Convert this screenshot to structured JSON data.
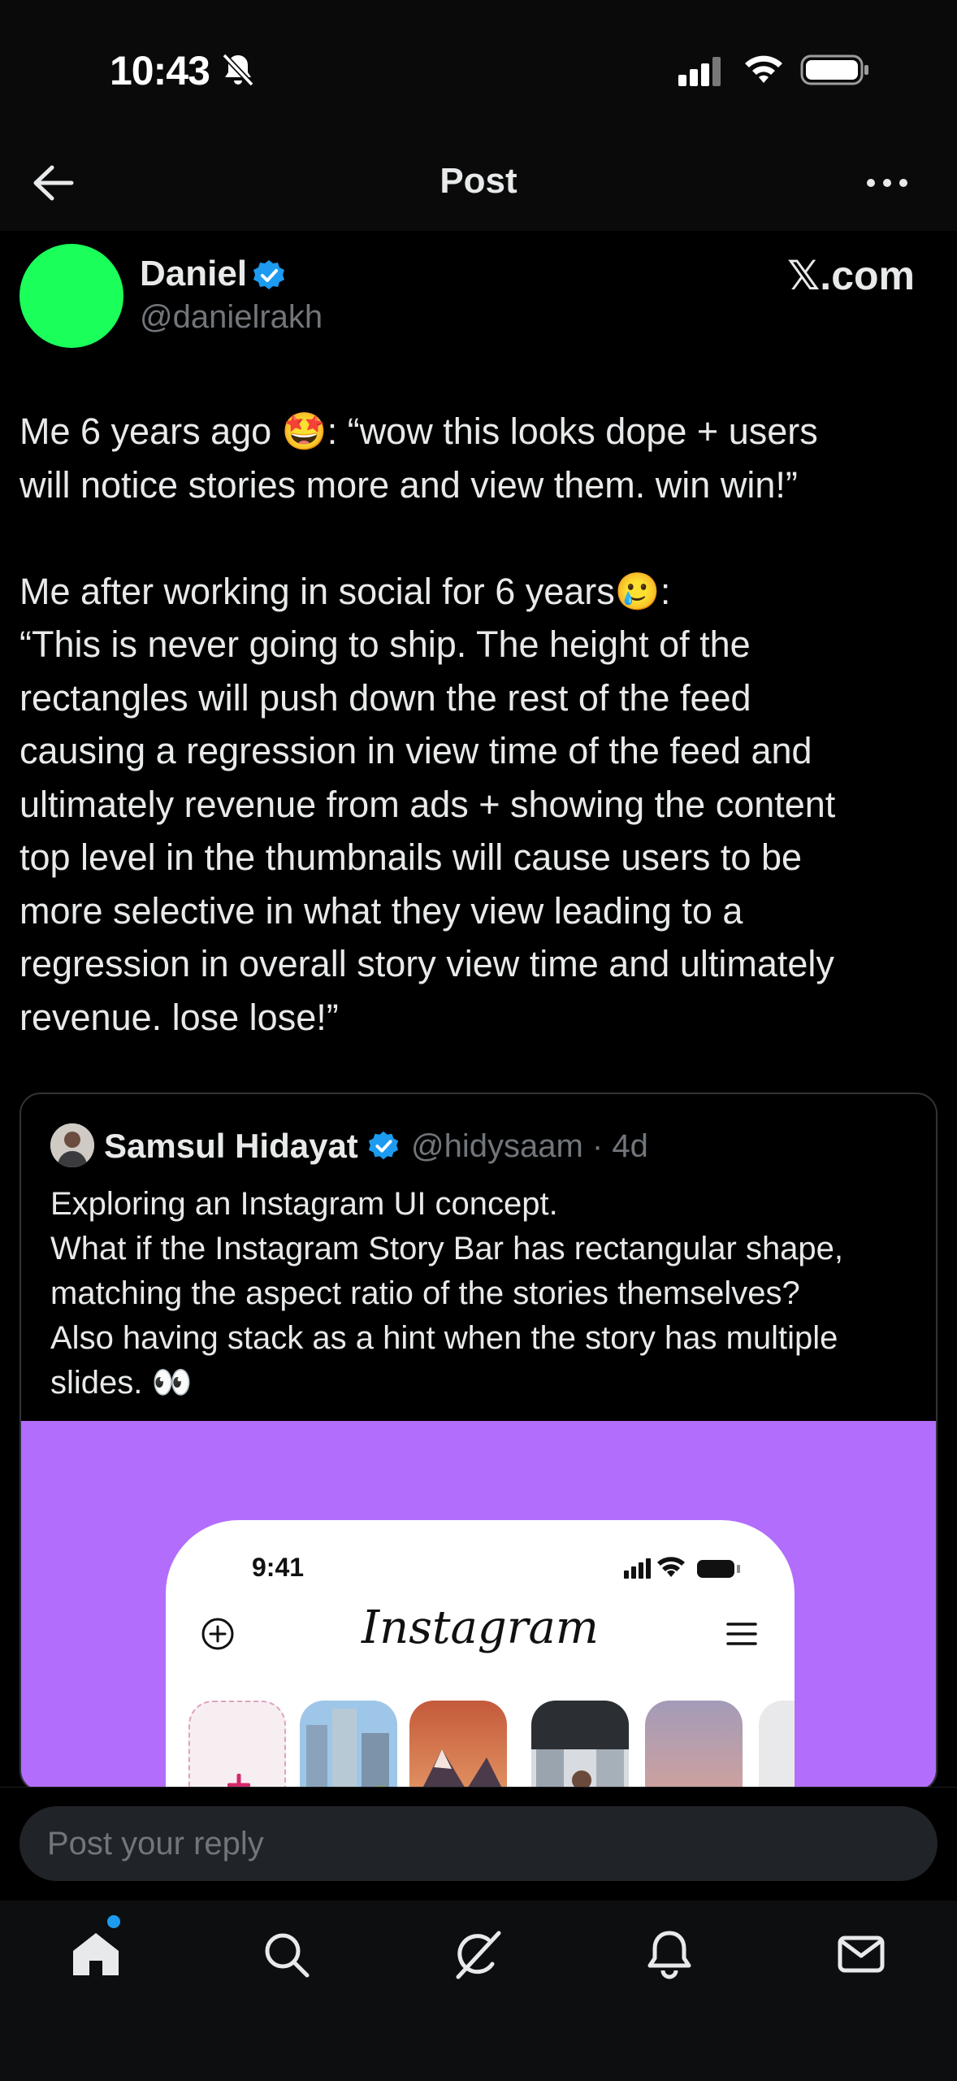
{
  "status_bar": {
    "time": "10:43",
    "icons": [
      "bell-off-icon",
      "cellular-signal-icon",
      "wifi-icon",
      "battery-icon"
    ]
  },
  "header": {
    "back_icon": "back-arrow-icon",
    "title": "Post",
    "more_icon": "more-dots-icon"
  },
  "post": {
    "author": {
      "name": "Daniel",
      "handle": "@danielrakh",
      "verified": true,
      "avatar_color": "#1aff5a"
    },
    "source_label": "𝕏.com",
    "lines": [
      "Me 6 years ago 🤩: “wow this looks dope + users",
      "will notice stories more and view them. win win!”",
      "",
      "Me after working in social for 6 years🥲:",
      "“This is never going to ship. The height of the",
      "rectangles will push down the rest of the feed",
      "causing a regression in view time of the feed and",
      "ultimately revenue from ads + showing the content",
      "top level in the thumbnails will cause users to be",
      "more selective in what they view leading to a",
      "regression in overall story view time and ultimately",
      "revenue. lose lose!”"
    ]
  },
  "quote": {
    "author_name": "Samsul Hidayat",
    "verified": true,
    "handle_time": "@hidysaam · 4d",
    "lines": [
      "Exploring an Instagram UI concept.",
      "What if the Instagram Story Bar has rectangular shape,",
      "matching the aspect ratio of the stories themselves?",
      "Also having stack as a hint when the story has multiple",
      "slides. 👀"
    ],
    "media": {
      "background": "#b26dfc",
      "phone_time": "9:41",
      "app_logo": "Instagram"
    }
  },
  "reply": {
    "placeholder": "Post your reply"
  },
  "bottom_nav": {
    "items": [
      "home-icon",
      "search-icon",
      "grok-icon",
      "notifications-icon",
      "messages-icon"
    ],
    "active": "home-icon",
    "accent": "#1d9bf0"
  },
  "colors": {
    "background": "#000000",
    "text": "#e7e9ea",
    "muted": "#71767b",
    "verified": "#1d9bf0"
  }
}
